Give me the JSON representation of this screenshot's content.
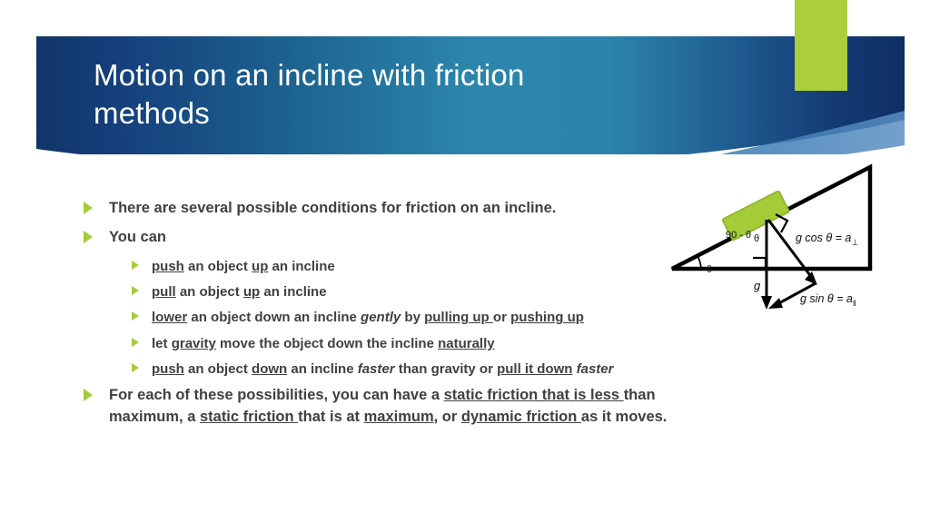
{
  "slide": {
    "title": "Motion on an incline with friction\nmethods",
    "accent_green": "#aacf3a",
    "banner_navy": "#143a72",
    "banner_teal": "#2b85ab",
    "bullet_green": "#a4cc38",
    "body_text_color": "#404040"
  },
  "body": {
    "bullets": [
      {
        "level": 1,
        "segments": [
          {
            "text": "There are several possible conditions for friction on an incline.",
            "style": "plain"
          }
        ]
      },
      {
        "level": 1,
        "segments": [
          {
            "text": "You can",
            "style": "plain"
          }
        ]
      },
      {
        "level": 2,
        "segments": [
          {
            "text": "push",
            "style": "underline"
          },
          {
            "text": " an object ",
            "style": "plain"
          },
          {
            "text": "up",
            "style": "underline"
          },
          {
            "text": " an incline",
            "style": "plain"
          }
        ]
      },
      {
        "level": 2,
        "segments": [
          {
            "text": "pull",
            "style": "underline"
          },
          {
            "text": " an object ",
            "style": "plain"
          },
          {
            "text": "up",
            "style": "underline"
          },
          {
            "text": " an incline",
            "style": "plain"
          }
        ]
      },
      {
        "level": 2,
        "segments": [
          {
            "text": "lower",
            "style": "underline"
          },
          {
            "text": " an object down an incline ",
            "style": "plain"
          },
          {
            "text": "gently",
            "style": "italic"
          },
          {
            "text": " by ",
            "style": "plain"
          },
          {
            "text": "pulling up ",
            "style": "underline"
          },
          {
            "text": "or ",
            "style": "plain"
          },
          {
            "text": "pushing up",
            "style": "underline"
          }
        ]
      },
      {
        "level": 2,
        "segments": [
          {
            "text": "let ",
            "style": "plain"
          },
          {
            "text": "gravity",
            "style": "underline"
          },
          {
            "text": " move the object down the incline ",
            "style": "plain"
          },
          {
            "text": "naturally",
            "style": "underline"
          }
        ]
      },
      {
        "level": 2,
        "segments": [
          {
            "text": "push",
            "style": "underline"
          },
          {
            "text": " an object ",
            "style": "plain"
          },
          {
            "text": "down",
            "style": "underline"
          },
          {
            "text": " an incline ",
            "style": "plain"
          },
          {
            "text": "faster",
            "style": "italic"
          },
          {
            "text": " than gravity or ",
            "style": "plain"
          },
          {
            "text": "pull it down",
            "style": "underline"
          },
          {
            "text": " ",
            "style": "plain"
          },
          {
            "text": "faster",
            "style": "italic"
          }
        ]
      },
      {
        "level": 1,
        "segments": [
          {
            "text": "For each of these possibilities, you can have a ",
            "style": "plain"
          },
          {
            "text": "static friction that is less ",
            "style": "underline"
          },
          {
            "text": "than maximum, a ",
            "style": "plain"
          },
          {
            "text": "static friction ",
            "style": "underline"
          },
          {
            "text": "that is at ",
            "style": "plain"
          },
          {
            "text": "maximum",
            "style": "underline"
          },
          {
            "text": ", or ",
            "style": "plain"
          },
          {
            "text": "dynamic friction ",
            "style": "underline"
          },
          {
            "text": "as it moves.",
            "style": "plain"
          }
        ]
      }
    ]
  },
  "diagram": {
    "name": "inclined-plane-gravity-components",
    "block_color": "#a4cc38",
    "labels": {
      "angle_base": "θ",
      "angle_complement": "90 - θ",
      "angle_vertical": "θ",
      "gravity": "g",
      "perpendicular_component": "g cos θ = a",
      "perpendicular_subscript": "⊥",
      "parallel_component": "g sin θ  = a",
      "parallel_subscript": "‖"
    }
  }
}
